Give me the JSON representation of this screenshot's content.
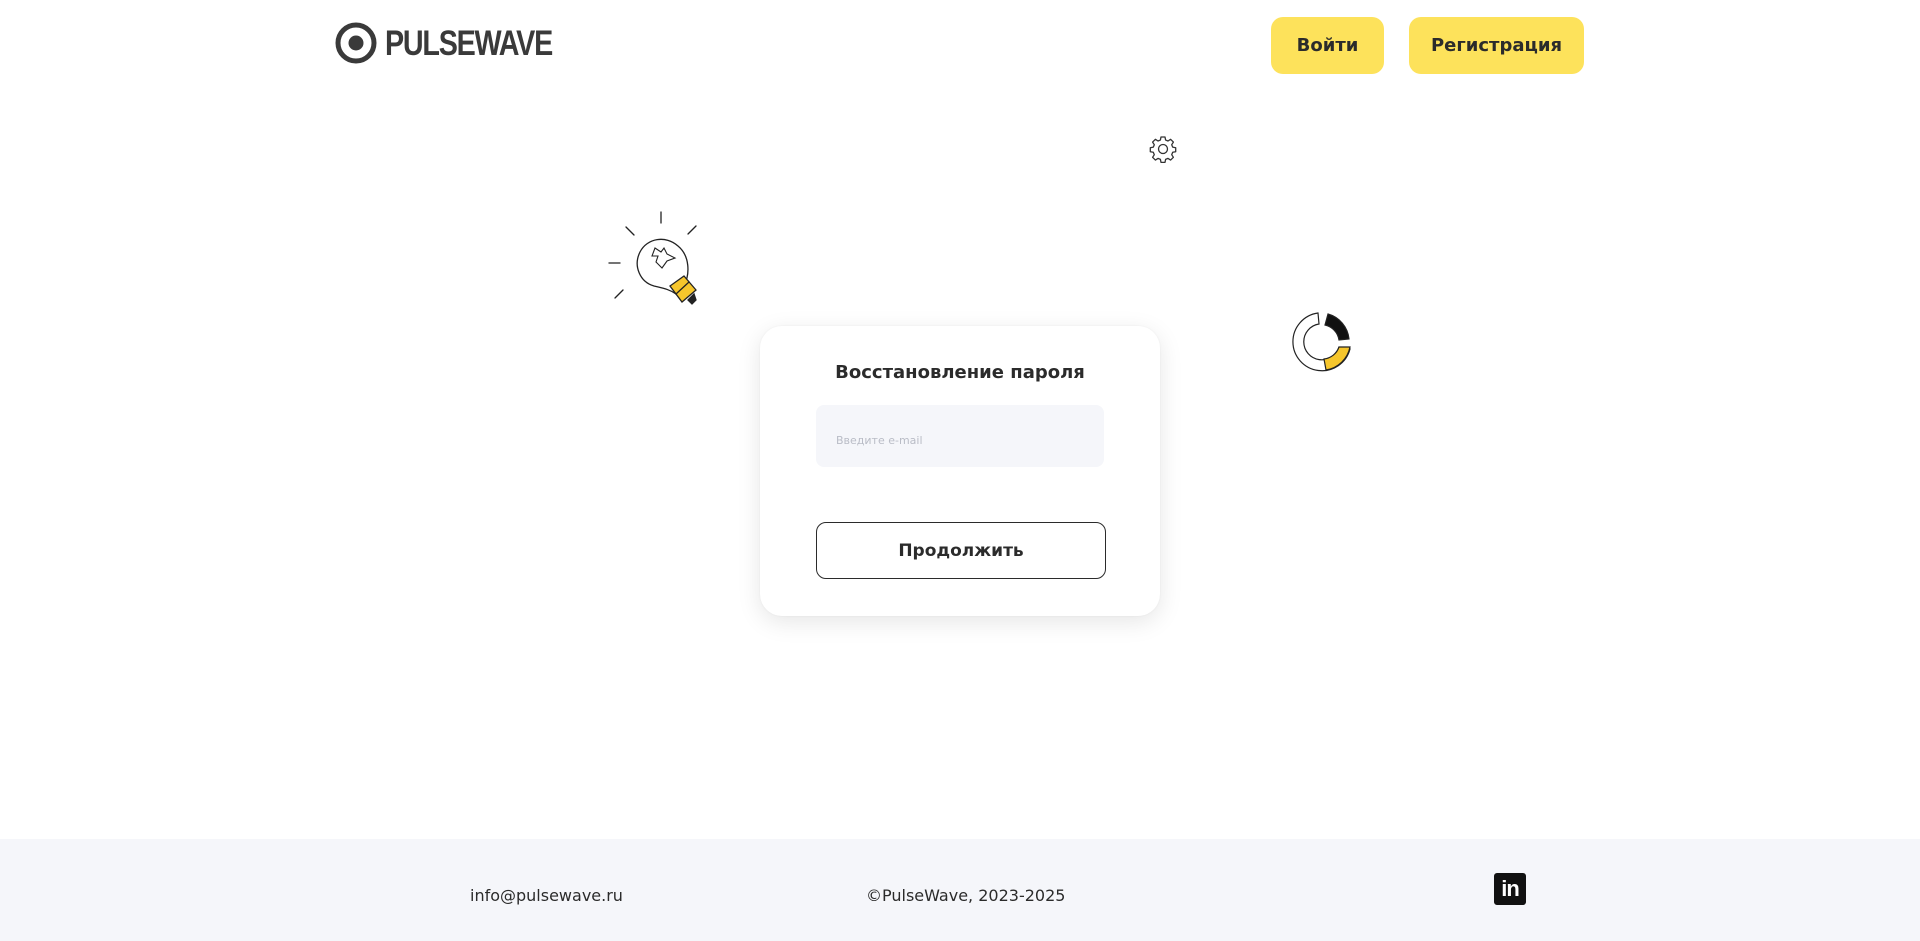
{
  "header": {
    "logo_text": "PULSEWAVE",
    "login_label": "Войти",
    "register_label": "Регистрация"
  },
  "card": {
    "title": "Восстановление пароля",
    "email_placeholder": "Введите e-mail",
    "email_value": "",
    "continue_label": "Продолжить"
  },
  "footer": {
    "email": "info@pulsewave.ru",
    "copyright": "©PulseWave, 2023-2025",
    "social_icon": "linkedin-icon"
  },
  "colors": {
    "accent_yellow": "#fde25b",
    "text_dark": "#2b2b2b",
    "footer_bg": "#f5f6fa"
  }
}
